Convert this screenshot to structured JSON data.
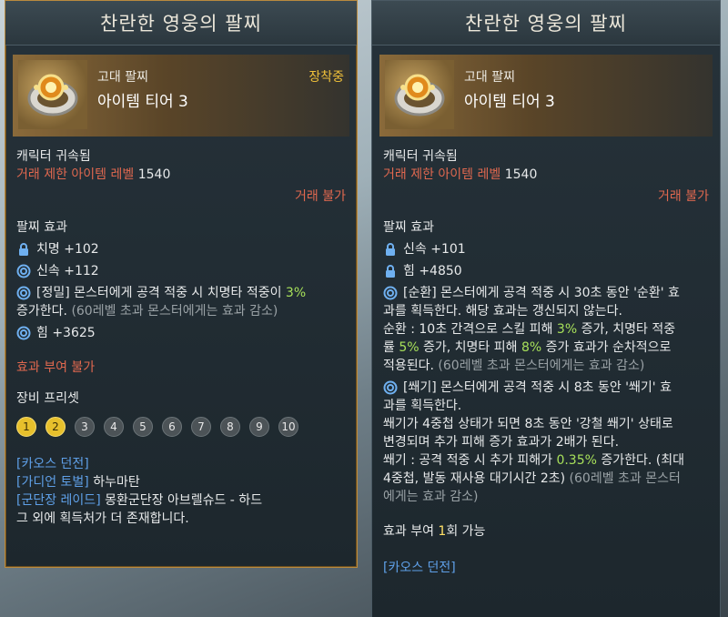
{
  "left": {
    "title": "찬란한 영웅의 팔찌",
    "grade": "고대 팔찌",
    "tier": "아이템 티어 3",
    "equipped": "장착중",
    "bound": "캐릭터 귀속됨",
    "trade_limit_label": "거래 제한 아이템 레벨",
    "trade_limit_value": "1540",
    "no_trade": "거래 불가",
    "effect_header": "팔찌 효과",
    "stat1": "치명 +102",
    "stat2": "신속 +112",
    "eff_a1": "[정밀] 몬스터에게 공격 적중 시 치명타 적중이 ",
    "eff_a2": "3%",
    "eff_a3": "증가한다.",
    "eff_a4": "(60레벨 초과 몬스터에게는 효과 감소)",
    "stat3": "힘 +3625",
    "no_grant": "효과 부여 불가",
    "preset_header": "장비 프리셋",
    "presets": [
      "1",
      "2",
      "3",
      "4",
      "5",
      "6",
      "7",
      "8",
      "9",
      "10"
    ],
    "sources": [
      "[카오스 던전]",
      "[가디언 토벌]",
      "하누마탄",
      "[군단장 레이드]",
      "몽환군단장 아브렐슈드 - 하드",
      "그 외에 획득처가 더 존재합니다."
    ]
  },
  "right": {
    "title": "찬란한 영웅의 팔찌",
    "grade": "고대 팔찌",
    "tier": "아이템 티어 3",
    "bound": "캐릭터 귀속됨",
    "trade_limit_label": "거래 제한 아이템 레벨",
    "trade_limit_value": "1540",
    "no_trade": "거래 불가",
    "effect_header": "팔찌 효과",
    "stat1": "신속 +101",
    "stat2": "힘 +4850",
    "cycle1": "[순환] 몬스터에게 공격 적중 시 30초 동안 '순환' 효",
    "cycle2": "과를 획득한다. 해당 효과는 갱신되지 않는다.",
    "cycle3a": "순환 : 10초 간격으로 스킬 피해 ",
    "cycle3b": "3%",
    "cycle3c": " 증가, 치명타 적중",
    "cycle4a": "률 ",
    "cycle4b": "5%",
    "cycle4c": " 증가, 치명타 피해 ",
    "cycle4d": "8%",
    "cycle4e": " 증가 효과가 순차적으로",
    "cycle5a": "적용된다. ",
    "cycle5b": "(60레벨 초과 몬스터에게는 효과 감소)",
    "wedge1": "[쐐기] 몬스터에게 공격 적중 시 8초 동안 '쐐기' 효",
    "wedge2": "과를 획득한다.",
    "wedge3": "쐐기가 4중첩 상태가 되면 8초 동안 '강철 쐐기' 상태로",
    "wedge4": "변경되며 추가 피해 증가 효과가 2배가 된다.",
    "wedge5a": "쐐기 : 공격 적중 시 추가 피해가 ",
    "wedge5b": "0.35%",
    "wedge5c": " 증가한다. (최대",
    "wedge6a": "4중첩, 발동 재사용 대기시간 2초) ",
    "wedge6b": "(60레벨 초과 몬스터",
    "wedge7": "에게는 효과 감소)",
    "grant_a": "효과 부여 ",
    "grant_b": "1",
    "grant_c": "회 가능",
    "source1": "[카오스 던전]"
  }
}
